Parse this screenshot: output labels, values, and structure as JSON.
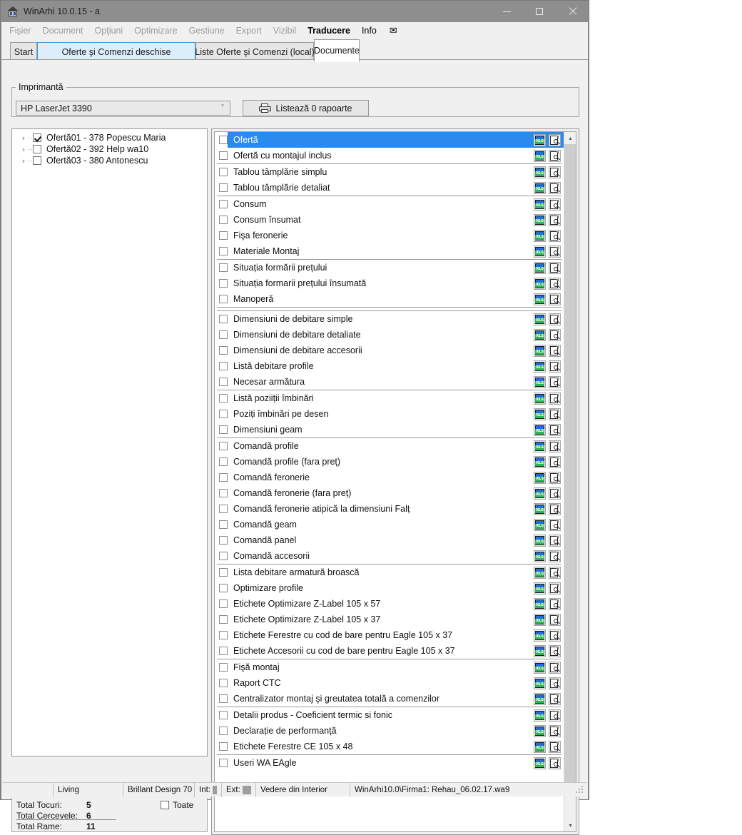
{
  "window": {
    "title": "WinArhi 10.0.15 - a",
    "icon": "app-house-icon",
    "buttons": {
      "minimize": "—",
      "maximize": "□",
      "close": "✕"
    }
  },
  "menu": {
    "items": [
      {
        "label": "Fişier",
        "state": "disabled"
      },
      {
        "label": "Document",
        "state": "disabled"
      },
      {
        "label": "Opţiuni",
        "state": "disabled"
      },
      {
        "label": "Optimizare",
        "state": "disabled"
      },
      {
        "label": "Gestiune",
        "state": "disabled"
      },
      {
        "label": "Export",
        "state": "disabled"
      },
      {
        "label": "Vizibil",
        "state": "disabled"
      },
      {
        "label": "Traducere",
        "state": "active"
      },
      {
        "label": "Info",
        "state": "enabled"
      }
    ],
    "mail_icon": "✉"
  },
  "tabs": [
    {
      "label": "Start",
      "state": "normal"
    },
    {
      "label": "Oferte şi Comenzi deschise",
      "state": "highlight"
    },
    {
      "label": "Liste Oferte şi Comenzi   (local)",
      "state": "normal"
    },
    {
      "label": "Documente",
      "state": "active"
    }
  ],
  "printer": {
    "legend": "Imprimantă",
    "selected": "HP LaserJet 3390",
    "dropdown_arrow": "˅",
    "print_button": "Listează 0 rapoarte",
    "print_icon": "printer-icon"
  },
  "tree": {
    "items": [
      {
        "label": "Ofertă01 - 378 Popescu Maria",
        "checked": true
      },
      {
        "label": "Ofertă02 - 392 Help wa10",
        "checked": false
      },
      {
        "label": "Ofertă03 - 380 Antonescu",
        "checked": false
      }
    ],
    "expander": "›"
  },
  "totals": {
    "rows": [
      {
        "label": "Total Tocuri:",
        "value": "5"
      },
      {
        "label": "Total Cercevele:",
        "value": "6"
      },
      {
        "label": "Total Rame:",
        "value": "11"
      }
    ],
    "toate_label": "Toate",
    "toate_checked": false
  },
  "documents": {
    "groups": [
      {
        "gap_after": false,
        "rows": [
          {
            "label": "Ofertă",
            "checked": false,
            "selected": true
          },
          {
            "label": "Ofertă cu montajul inclus",
            "checked": false,
            "selected": false
          }
        ]
      },
      {
        "gap_after": false,
        "rows": [
          {
            "label": "Tablou tâmplărie simplu",
            "checked": false,
            "selected": false
          },
          {
            "label": "Tablou tâmplărie detaliat",
            "checked": false,
            "selected": false
          }
        ]
      },
      {
        "gap_after": false,
        "rows": [
          {
            "label": "Consum",
            "checked": false,
            "selected": false
          },
          {
            "label": "Consum însumat",
            "checked": false,
            "selected": false
          },
          {
            "label": "Fişa feronerie",
            "checked": false,
            "selected": false
          },
          {
            "label": "Materiale Montaj",
            "checked": false,
            "selected": false
          }
        ]
      },
      {
        "gap_after": true,
        "rows": [
          {
            "label": "Situația formării prețului",
            "checked": false,
            "selected": false
          },
          {
            "label": "Situația formarii prețului însumată",
            "checked": false,
            "selected": false
          },
          {
            "label": "Manoperă",
            "checked": false,
            "selected": false
          }
        ]
      },
      {
        "gap_after": false,
        "rows": [
          {
            "label": "Dimensiuni de debitare simple",
            "checked": false,
            "selected": false
          },
          {
            "label": "Dimensiuni de debitare detaliate",
            "checked": false,
            "selected": false
          },
          {
            "label": "Dimensiuni de debitare accesorii",
            "checked": false,
            "selected": false
          },
          {
            "label": "Listă debitare profile",
            "checked": false,
            "selected": false
          },
          {
            "label": "Necesar armătura",
            "checked": false,
            "selected": false
          }
        ]
      },
      {
        "gap_after": false,
        "rows": [
          {
            "label": "Listă poziiții îmbinări",
            "checked": false,
            "selected": false
          },
          {
            "label": "Poziți îmbinări pe desen",
            "checked": false,
            "selected": false
          },
          {
            "label": "Dimensiuni geam",
            "checked": false,
            "selected": false
          }
        ]
      },
      {
        "gap_after": false,
        "rows": [
          {
            "label": "Comandă profile",
            "checked": false,
            "selected": false
          },
          {
            "label": "Comandă profile (fara preț)",
            "checked": false,
            "selected": false
          },
          {
            "label": "Comandă feronerie",
            "checked": false,
            "selected": false
          },
          {
            "label": "Comandă feronerie (fara preț)",
            "checked": false,
            "selected": false
          },
          {
            "label": "Comandă feronerie atipică la dimensiuni Falț",
            "checked": false,
            "selected": false
          },
          {
            "label": "Comandă geam",
            "checked": false,
            "selected": false
          },
          {
            "label": "Comandă panel",
            "checked": false,
            "selected": false
          },
          {
            "label": "Comandă accesorii",
            "checked": false,
            "selected": false
          }
        ]
      },
      {
        "gap_after": false,
        "rows": [
          {
            "label": "Lista debitare armatură broască",
            "checked": false,
            "selected": false
          },
          {
            "label": "Optimizare profile",
            "checked": false,
            "selected": false
          },
          {
            "label": "Etichete Optimizare Z-Label 105 x 57",
            "checked": false,
            "selected": false
          },
          {
            "label": "Etichete Optimizare Z-Label 105 x 37",
            "checked": false,
            "selected": false
          },
          {
            "label": "Etichete Ferestre cu cod de bare pentru Eagle 105 x 37",
            "checked": false,
            "selected": false
          },
          {
            "label": "Etichete Accesorii cu cod de bare pentru Eagle 105 x 37",
            "checked": false,
            "selected": false
          }
        ]
      },
      {
        "gap_after": false,
        "rows": [
          {
            "label": "Fişă montaj",
            "checked": false,
            "selected": false
          },
          {
            "label": "Raport CTC",
            "checked": false,
            "selected": false
          },
          {
            "label": "Centralizator montaj şi greutatea totală a comenzilor",
            "checked": false,
            "selected": false
          }
        ]
      },
      {
        "gap_after": false,
        "rows": [
          {
            "label": "Detalii produs - Coeficient termic si fonic",
            "checked": false,
            "selected": false
          },
          {
            "label": "Declarație de performanță",
            "checked": false,
            "selected": false
          },
          {
            "label": "Etichete Ferestre CE 105 x 48",
            "checked": false,
            "selected": false
          }
        ]
      },
      {
        "gap_after": false,
        "rows": [
          {
            "label": "Useri WA EAgle",
            "checked": false,
            "selected": false
          }
        ]
      }
    ],
    "row_icons": {
      "export": "xls-icon",
      "preview": "preview-icon"
    },
    "scrollbar": {
      "up": "▴",
      "down": "▾"
    }
  },
  "status_bar": {
    "cells": [
      {
        "text": "",
        "type": "spacer"
      },
      {
        "text": "Living",
        "type": "text"
      },
      {
        "text": "Brillant Design 70",
        "type": "text"
      },
      {
        "text": "Int:",
        "type": "swatch"
      },
      {
        "text": "Ext:",
        "type": "swatch"
      },
      {
        "text": "Vedere din Interior",
        "type": "text"
      },
      {
        "text": "WinArhi10.0\\Firma1: Rehau_06.02.17.wa9",
        "type": "text"
      }
    ]
  }
}
